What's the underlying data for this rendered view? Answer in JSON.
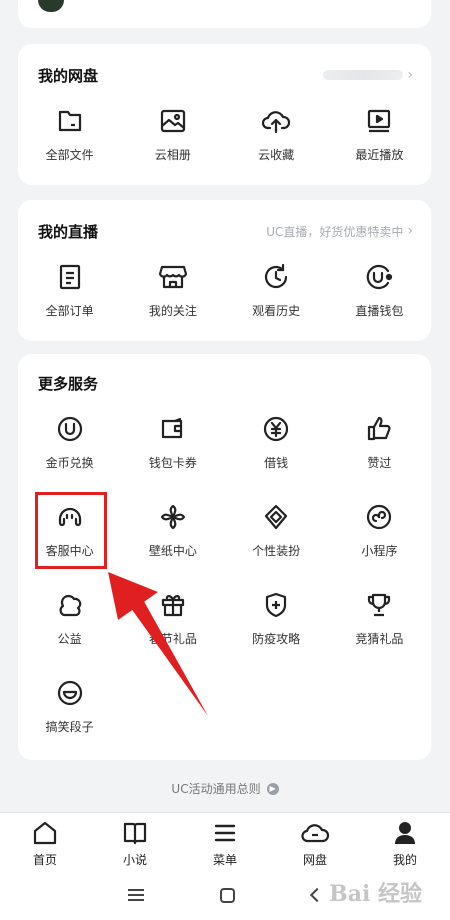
{
  "netdisk": {
    "title": "我的网盘",
    "items": [
      {
        "label": "全部文件",
        "icon": "folder-icon"
      },
      {
        "label": "云相册",
        "icon": "image-icon"
      },
      {
        "label": "云收藏",
        "icon": "cloud-upload-icon"
      },
      {
        "label": "最近播放",
        "icon": "play-screen-icon"
      }
    ]
  },
  "live": {
    "title": "我的直播",
    "subtitle": "UC直播，好货优惠特卖中",
    "items": [
      {
        "label": "全部订单",
        "icon": "order-list-icon"
      },
      {
        "label": "我的关注",
        "icon": "store-icon"
      },
      {
        "label": "观看历史",
        "icon": "history-clock-icon"
      },
      {
        "label": "直播钱包",
        "icon": "live-wallet-icon"
      }
    ]
  },
  "more": {
    "title": "更多服务",
    "items": [
      {
        "label": "金币兑换",
        "icon": "coin-exchange-icon"
      },
      {
        "label": "钱包卡券",
        "icon": "wallet-icon"
      },
      {
        "label": "借钱",
        "icon": "yuan-icon"
      },
      {
        "label": "赞过",
        "icon": "thumbs-up-icon"
      },
      {
        "label": "客服中心",
        "icon": "customer-service-icon"
      },
      {
        "label": "壁纸中心",
        "icon": "pinwheel-icon"
      },
      {
        "label": "个性装扮",
        "icon": "style-icon"
      },
      {
        "label": "小程序",
        "icon": "mini-program-icon"
      },
      {
        "label": "公益",
        "icon": "charity-icon"
      },
      {
        "label": "春节礼品",
        "icon": "gift-icon"
      },
      {
        "label": "防疫攻略",
        "icon": "shield-plus-icon"
      },
      {
        "label": "竞猜礼品",
        "icon": "trophy-icon"
      },
      {
        "label": "搞笑段子",
        "icon": "smile-icon"
      }
    ]
  },
  "footer_link": "UC活动通用总则",
  "tabbar": [
    {
      "label": "首页",
      "icon": "home-icon"
    },
    {
      "label": "小说",
      "icon": "book-icon"
    },
    {
      "label": "菜单",
      "icon": "menu-icon"
    },
    {
      "label": "网盘",
      "icon": "cloud-icon"
    },
    {
      "label": "我的",
      "icon": "user-icon"
    }
  ],
  "watermark": "Bai 经验",
  "colors": {
    "highlight": "#e02020",
    "background": "#f2f3f5",
    "card": "#ffffff"
  }
}
